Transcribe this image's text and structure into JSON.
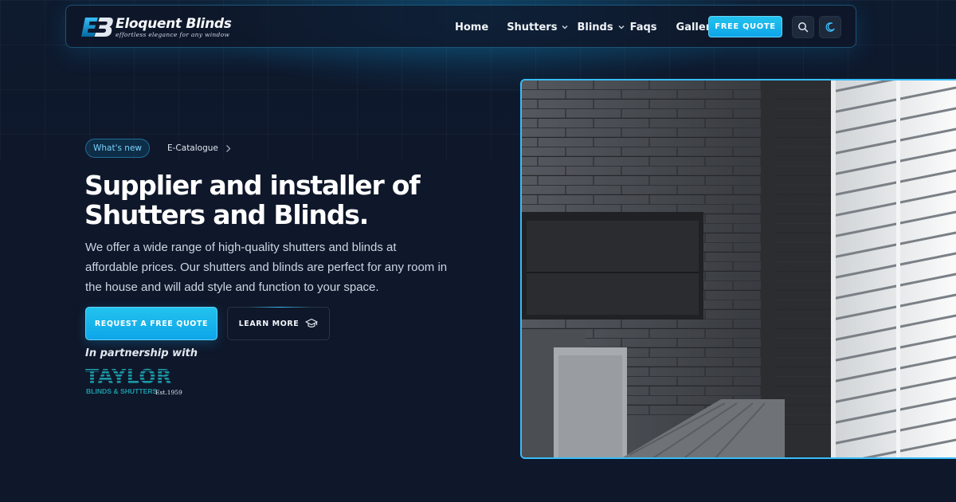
{
  "brand": {
    "logo_mark": "EB",
    "name": "Eloquent Blinds",
    "tagline": "effortless elegance for any window"
  },
  "nav": {
    "links": [
      {
        "label": "Home",
        "has_dropdown": false
      },
      {
        "label": "Shutters",
        "has_dropdown": true
      },
      {
        "label": "Blinds",
        "has_dropdown": true
      },
      {
        "label": "Faqs",
        "has_dropdown": false
      },
      {
        "label": "Gallery",
        "has_dropdown": false
      }
    ],
    "quote_button": "FREE QUOTE",
    "search_icon": "search-icon",
    "theme_icon": "moon-icon"
  },
  "hero": {
    "badge": "What's new",
    "catalogue_link": "E-Catalogue",
    "headline_line1": "Supplier and installer of",
    "headline_line2": "Shutters and Blinds.",
    "description": "We offer a wide range of high-quality shutters and blinds at affordable prices. Our shutters and blinds are perfect for any room in the house and will add style and function to your space.",
    "primary_button": "REQUEST A FREE QUOTE",
    "secondary_button": "LEARN MORE",
    "secondary_icon": "graduation-cap-icon",
    "partnership_label": "In partnership with",
    "partner": {
      "name": "TAYLOR",
      "sub": "BLINDS & SHUTTERS",
      "est": "Est.1959"
    },
    "image_alt": "room with stone wall and white shutters"
  },
  "colors": {
    "background": "#0f172a",
    "accent": "#0ea5e9",
    "accent_light": "#38bdf8",
    "partner_teal": "#1b9aa8"
  }
}
